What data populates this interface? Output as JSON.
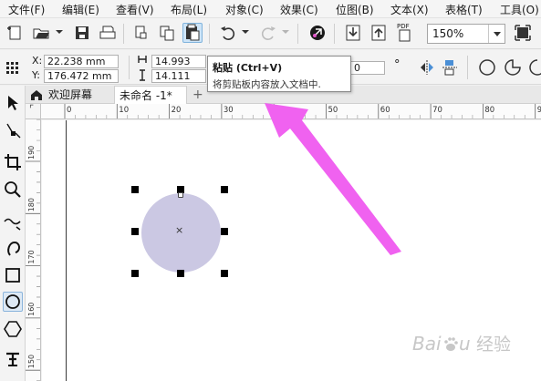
{
  "menu": [
    {
      "label": "文件(F)"
    },
    {
      "label": "编辑(E)"
    },
    {
      "label": "查看(V)"
    },
    {
      "label": "布局(L)"
    },
    {
      "label": "对象(C)"
    },
    {
      "label": "效果(C)"
    },
    {
      "label": "位图(B)"
    },
    {
      "label": "文本(X)"
    },
    {
      "label": "表格(T)"
    },
    {
      "label": "工具(O)"
    }
  ],
  "toolbar": {
    "zoom_value": "150%",
    "pdf_label": "PDF"
  },
  "props": {
    "x_label": "X:",
    "x_value": "22.238 mm",
    "y_label": "Y:",
    "y_value": "176.472 mm",
    "width_value": "14.993 mm",
    "height_value": "14.111 mm",
    "angle_value": "0",
    "degree_symbol": "°"
  },
  "tooltip": {
    "title": "粘贴 (Ctrl+V)",
    "description": "将剪贴板内容放入文档中."
  },
  "tabs": {
    "welcome_label": "欢迎屏幕",
    "doc_label": "未命名 -1*",
    "add_label": "+"
  },
  "ruler": {
    "corner_symbol": "⌜",
    "h_ticks": [
      "0",
      "10",
      "20",
      "30",
      "40",
      "50",
      "60",
      "70",
      "80",
      "90"
    ],
    "v_ticks": [
      "190",
      "180",
      "170",
      "160",
      "150"
    ]
  },
  "canvas": {
    "ellipse_fill": "#cbc8e3",
    "center_mark": "×"
  },
  "watermark": {
    "text": "Baidu经验"
  },
  "colors": {
    "arrow": "#f062f0",
    "selection_handle": "#000000"
  }
}
